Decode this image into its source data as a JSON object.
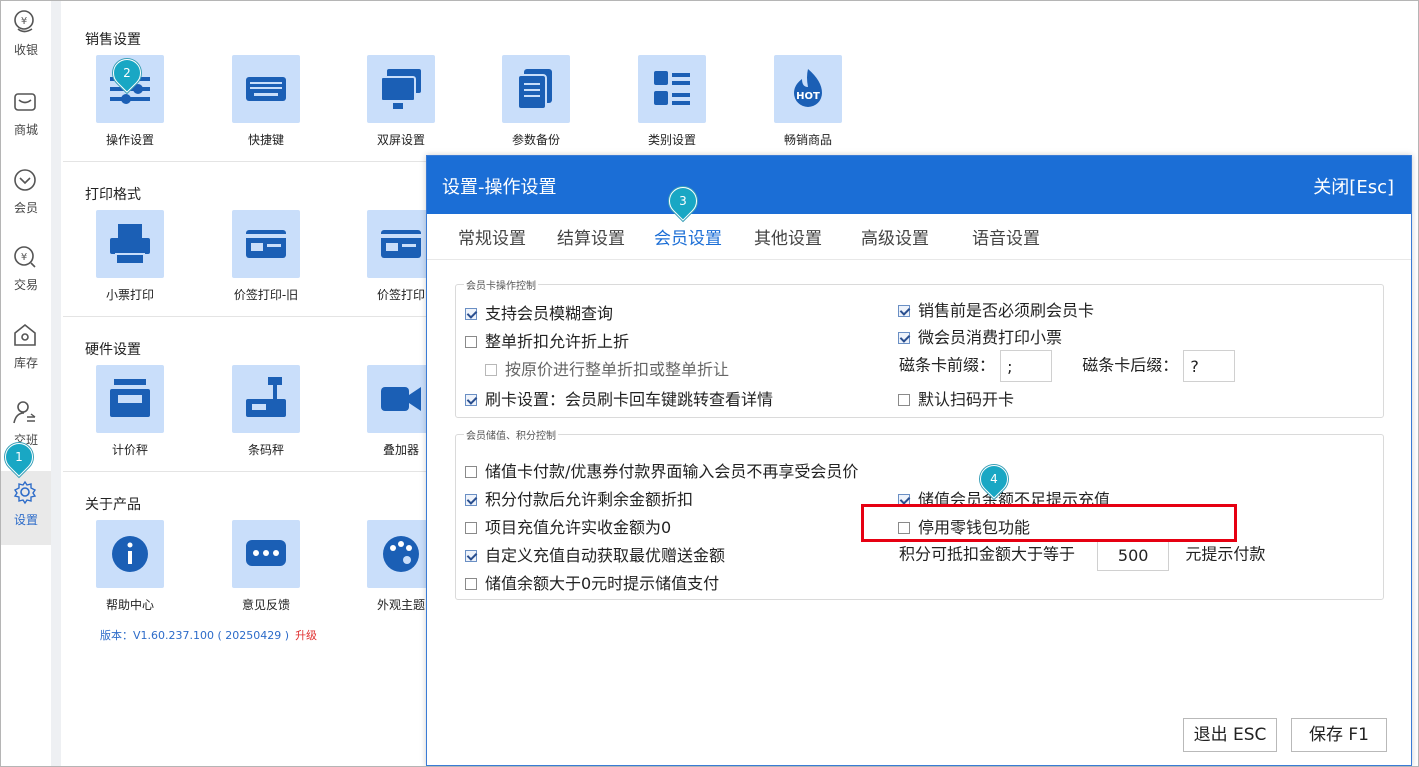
{
  "rail": {
    "items": [
      {
        "label": "收银",
        "icon": "cashier-icon"
      },
      {
        "label": "商城",
        "icon": "shop-icon"
      },
      {
        "label": "会员",
        "icon": "member-icon"
      },
      {
        "label": "交易",
        "icon": "trade-icon"
      },
      {
        "label": "库存",
        "icon": "inventory-icon"
      },
      {
        "label": "交班",
        "icon": "shift-icon"
      },
      {
        "label": "设置",
        "icon": "settings-gear-icon"
      }
    ]
  },
  "sections": {
    "sales": {
      "title": "销售设置",
      "tiles": [
        {
          "label": "操作设置",
          "icon": "operation-settings-icon"
        },
        {
          "label": "快捷键",
          "icon": "keyboard-icon"
        },
        {
          "label": "双屏设置",
          "icon": "dual-screen-icon"
        },
        {
          "label": "参数备份",
          "icon": "backup-icon"
        },
        {
          "label": "类别设置",
          "icon": "category-icon"
        },
        {
          "label": "畅销商品",
          "icon": "hot-icon"
        }
      ]
    },
    "print": {
      "title": "打印格式",
      "tiles": [
        {
          "label": "小票打印",
          "icon": "printer-icon"
        },
        {
          "label": "价签打印-旧",
          "icon": "price-tag-icon"
        },
        {
          "label": "价签打印",
          "icon": "price-tag-icon"
        }
      ]
    },
    "hardware": {
      "title": "硬件设置",
      "tiles": [
        {
          "label": "计价秤",
          "icon": "pricing-scale-icon"
        },
        {
          "label": "条码秤",
          "icon": "barcode-scale-icon"
        },
        {
          "label": "叠加器",
          "icon": "video-icon"
        }
      ]
    },
    "about": {
      "title": "关于产品",
      "tiles": [
        {
          "label": "帮助中心",
          "icon": "info-icon"
        },
        {
          "label": "意见反馈",
          "icon": "feedback-icon"
        },
        {
          "label": "外观主题",
          "icon": "palette-icon"
        }
      ],
      "version": "版本：V1.60.237.100 ( 20250429 )",
      "upgrade": "升级"
    }
  },
  "badges": [
    "1",
    "2",
    "3",
    "4"
  ],
  "dialog": {
    "title": "设置-操作设置",
    "close": "关闭[Esc]",
    "tabs": [
      "常规设置",
      "结算设置",
      "会员设置",
      "其他设置",
      "高级设置",
      "语音设置"
    ],
    "active_tab": "会员设置",
    "group1": {
      "title": "会员卡操作控制",
      "left": [
        {
          "label": "支持会员模糊查询",
          "checked": true
        },
        {
          "label": "整单折扣允许折上折",
          "checked": false
        },
        {
          "label": "按原价进行整单折扣或整单折让",
          "checked": false
        },
        {
          "label": "刷卡设置：会员刷卡回车键跳转查看详情",
          "checked": true
        }
      ],
      "right": [
        {
          "label": "销售前是否必须刷会员卡",
          "checked": true
        },
        {
          "label": "微会员消费打印小票",
          "checked": true
        },
        {
          "label": "默认扫码开卡",
          "checked": false
        }
      ],
      "prefix_label": "磁条卡前缀：",
      "prefix_value": ";",
      "suffix_label": "磁条卡后缀：",
      "suffix_value": "?"
    },
    "group2": {
      "title": "会员储值、积分控制",
      "left": [
        {
          "label": "储值卡付款/优惠券付款界面输入会员不再享受会员价",
          "checked": false
        },
        {
          "label": "积分付款后允许剩余金额折扣",
          "checked": true
        },
        {
          "label": "项目充值允许实收金额为0",
          "checked": false
        },
        {
          "label": "自定义充值自动获取最优赠送金额",
          "checked": true
        },
        {
          "label": "储值余额大于0元时提示储值支付",
          "checked": false
        }
      ],
      "right": [
        {
          "label": "储值会员余额不足提示充值",
          "checked": true
        },
        {
          "label": "停用零钱包功能",
          "checked": false
        }
      ],
      "points_label": "积分可抵扣金额大于等于",
      "points_value": "500",
      "points_suffix": "元提示付款"
    },
    "buttons": {
      "exit": "退出 ESC",
      "save": "保存 F1"
    }
  },
  "colors": {
    "accent": "#1b6ed6",
    "tile": "#c9defa",
    "highlight": "#e60012",
    "badge": "#19a7c4"
  }
}
